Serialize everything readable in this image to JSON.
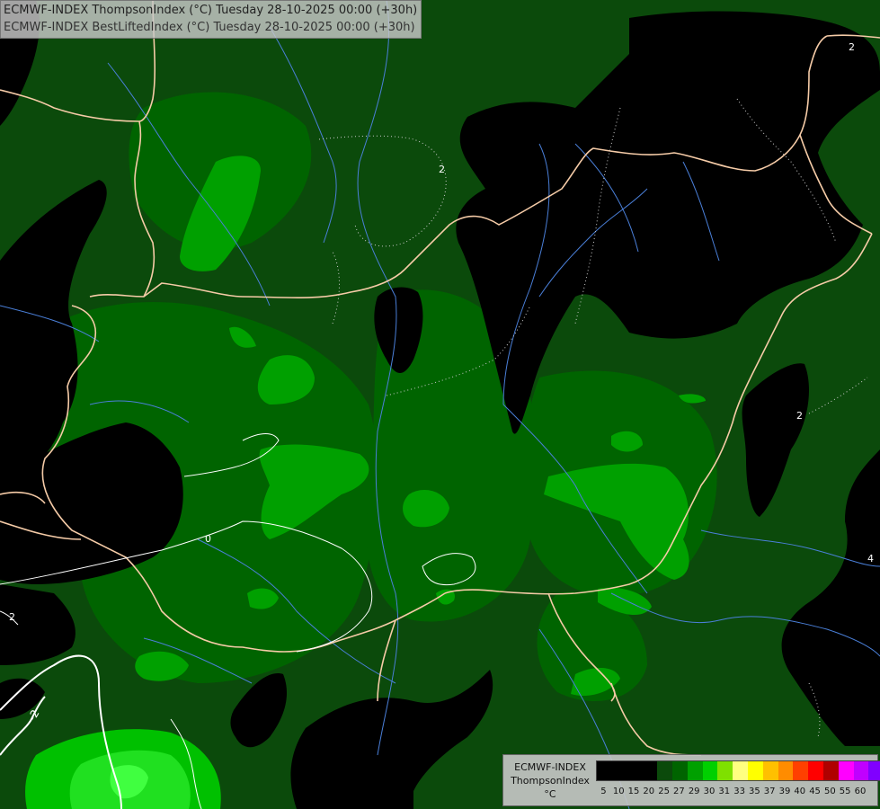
{
  "header": {
    "line1": "ECMWF-INDEX ThompsonIndex (°C) Tuesday 28-10-2025 00:00 (+30h)",
    "line2": "ECMWF-INDEX BestLiftedIndex (°C) Tuesday 28-10-2025 00:00 (+30h)"
  },
  "legend": {
    "title_line1": "ECMWF-INDEX",
    "title_line2": "ThompsonIndex",
    "title_line3": "°C",
    "swatch_colors": [
      "#000000",
      "#000000",
      "#000000",
      "#000000",
      "#0b4a0b",
      "#006400",
      "#00a000",
      "#00d000",
      "#7fe000",
      "#ffff80",
      "#ffff00",
      "#ffc000",
      "#ff8c00",
      "#ff4000",
      "#ff0000",
      "#b00000",
      "#ff00ff",
      "#c000ff",
      "#8000ff",
      "#4020ff",
      "#0000ff"
    ],
    "ticks": [
      "5",
      "10",
      "15",
      "20",
      "25",
      "27",
      "29",
      "30",
      "31",
      "33",
      "35",
      "37",
      "39",
      "40",
      "45",
      "50",
      "55",
      "60"
    ]
  },
  "map": {
    "contour_labels": [
      "2",
      "0",
      "2",
      "2",
      "-2",
      "2",
      "4"
    ],
    "colors": {
      "background": "#0b3d0b",
      "dark_green": "#0b4a0b",
      "medium_green": "#006400",
      "bright_green": "#00a000",
      "light_green": "#00d000",
      "lime": "#33ff33",
      "black": "#000000",
      "borders": "#f5cba7",
      "rivers": "#4a7fd8",
      "contours": "#ffffff"
    }
  }
}
